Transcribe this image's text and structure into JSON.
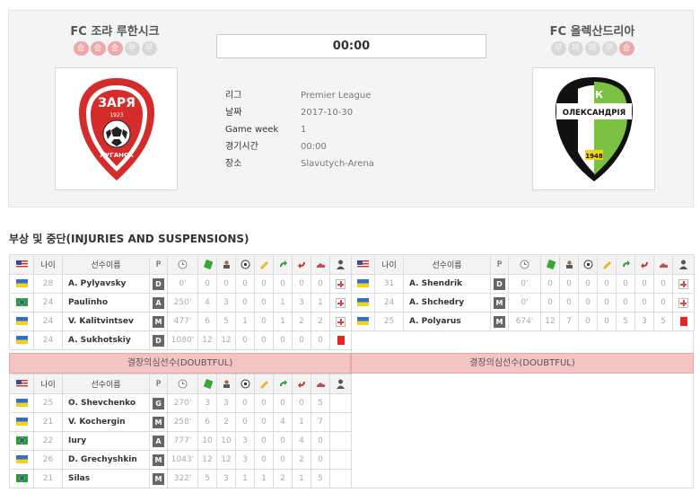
{
  "home": {
    "name": "FC 조랴 루한시크",
    "form": [
      "승",
      "승",
      "승",
      "무",
      "무"
    ],
    "logo_text_top": "ЗАРЯ",
    "logo_text_year": "1923",
    "logo_text_bottom": "ЛУГАНСК"
  },
  "away": {
    "name": "FC 올렉산드리아",
    "form": [
      "무",
      "패",
      "패",
      "무",
      "승"
    ],
    "logo_text_top": "ФК",
    "logo_text_mid": "ОЛЕКСАНДРІЯ",
    "logo_text_year": "1948"
  },
  "score": "00:00",
  "info": [
    {
      "key": "리그",
      "value": "Premier League"
    },
    {
      "key": "날짜",
      "value": "2017-10-30"
    },
    {
      "key": "Game week",
      "value": "1"
    },
    {
      "key": "경기시간",
      "value": "00:00"
    },
    {
      "key": "장소",
      "value": "Slavutych-Arena"
    }
  ],
  "section_title": "부상 및 중단(INJURIES AND SUSPENSIONS)",
  "columns": {
    "age": "나이",
    "name": "선수이름",
    "pos": "P"
  },
  "doubtful_label": "결장의심선수(DOUBTFUL)",
  "home_injuries": [
    {
      "flag": "ua",
      "age": "28",
      "name": "A. Pylyavsky",
      "pos": "D",
      "min": "0'",
      "s": [
        "0",
        "0",
        "0",
        "0",
        "0",
        "0",
        "0"
      ],
      "status": "injury"
    },
    {
      "flag": "br",
      "age": "24",
      "name": "Paulinho",
      "pos": "A",
      "min": "250'",
      "s": [
        "4",
        "3",
        "0",
        "0",
        "1",
        "3",
        "1"
      ],
      "status": "injury"
    },
    {
      "flag": "ua",
      "age": "24",
      "name": "V. Kalitvintsev",
      "pos": "M",
      "min": "477'",
      "s": [
        "6",
        "5",
        "1",
        "0",
        "1",
        "2",
        "2"
      ],
      "status": "injury"
    },
    {
      "flag": "ua",
      "age": "24",
      "name": "A. Sukhotskiy",
      "pos": "D",
      "min": "1080'",
      "s": [
        "12",
        "12",
        "0",
        "0",
        "0",
        "0",
        "0"
      ],
      "status": "red"
    }
  ],
  "away_injuries": [
    {
      "flag": "ua",
      "age": "31",
      "name": "A. Shendrik",
      "pos": "D",
      "min": "0'",
      "s": [
        "0",
        "0",
        "0",
        "0",
        "0",
        "0",
        "0"
      ],
      "status": "injury"
    },
    {
      "flag": "ua",
      "age": "24",
      "name": "A. Shchedry",
      "pos": "M",
      "min": "0'",
      "s": [
        "0",
        "0",
        "0",
        "0",
        "0",
        "0",
        "0"
      ],
      "status": "injury"
    },
    {
      "flag": "ua",
      "age": "25",
      "name": "A. Polyarus",
      "pos": "M",
      "min": "674'",
      "s": [
        "12",
        "7",
        "0",
        "0",
        "5",
        "3",
        "5"
      ],
      "status": "red"
    }
  ],
  "home_doubtful": [
    {
      "flag": "ua",
      "age": "25",
      "name": "O. Shevchenko",
      "pos": "G",
      "min": "270'",
      "s": [
        "3",
        "3",
        "0",
        "0",
        "0",
        "0",
        "5"
      ]
    },
    {
      "flag": "ua",
      "age": "21",
      "name": "V. Kochergin",
      "pos": "M",
      "min": "258'",
      "s": [
        "6",
        "2",
        "0",
        "0",
        "4",
        "1",
        "7"
      ]
    },
    {
      "flag": "br",
      "age": "22",
      "name": "Iury",
      "pos": "A",
      "min": "777'",
      "s": [
        "10",
        "10",
        "3",
        "0",
        "0",
        "4",
        "0"
      ]
    },
    {
      "flag": "ua",
      "age": "26",
      "name": "D. Grechyshkin",
      "pos": "M",
      "min": "1043'",
      "s": [
        "12",
        "12",
        "3",
        "0",
        "0",
        "2",
        "0"
      ]
    },
    {
      "flag": "br",
      "age": "21",
      "name": "Silas",
      "pos": "M",
      "min": "322'",
      "s": [
        "5",
        "3",
        "1",
        "1",
        "2",
        "1",
        "5"
      ]
    }
  ]
}
